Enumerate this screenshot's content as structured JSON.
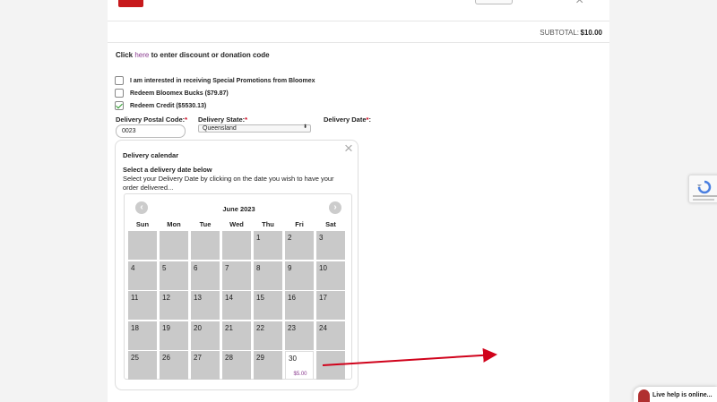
{
  "cart": {
    "subtotal_label": "SUBTOTAL:",
    "subtotal_value": "$10.00"
  },
  "discount": {
    "prefix": "Click",
    "link": "here",
    "suffix": "to enter discount or donation code"
  },
  "options": [
    {
      "label": "I am interested in receiving Special Promotions from Bloomex",
      "checked": false
    },
    {
      "label": "Redeem Bloomex Bucks ($79.87)",
      "checked": false
    },
    {
      "label": "Redeem Credit ($5530.13)",
      "checked": true
    }
  ],
  "delivery": {
    "postal_label": "Delivery Postal Code:",
    "postal_value": "0023",
    "state_label": "Delivery State:",
    "state_value": "Queensland",
    "date_label": "Delivery Date",
    "required_mark": "*",
    "colon": ":"
  },
  "calendar": {
    "title": "Delivery calendar",
    "subtitle": "Select a delivery date below",
    "description": "Select your Delivery Date by clicking on the date you wish to have your order delivered...",
    "month": "June 2023",
    "weekdays": [
      "Sun",
      "Mon",
      "Tue",
      "Wed",
      "Thu",
      "Fri",
      "Sat"
    ],
    "weeks": [
      [
        "",
        "",
        "",
        "",
        "1",
        "2",
        "3"
      ],
      [
        "4",
        "5",
        "6",
        "7",
        "8",
        "9",
        "10"
      ],
      [
        "11",
        "12",
        "13",
        "14",
        "15",
        "16",
        "17"
      ],
      [
        "18",
        "19",
        "20",
        "21",
        "22",
        "23",
        "24"
      ],
      [
        "25",
        "26",
        "27",
        "28",
        "29",
        "30",
        ""
      ]
    ],
    "available_day": "30",
    "available_price": "$5.00"
  },
  "colors": {
    "accent": "#8a3b8f",
    "annotation_arrow": "#d0021b",
    "unavailable_day": "#c9c9c9"
  },
  "live_help": {
    "label": "Live help is online..."
  }
}
